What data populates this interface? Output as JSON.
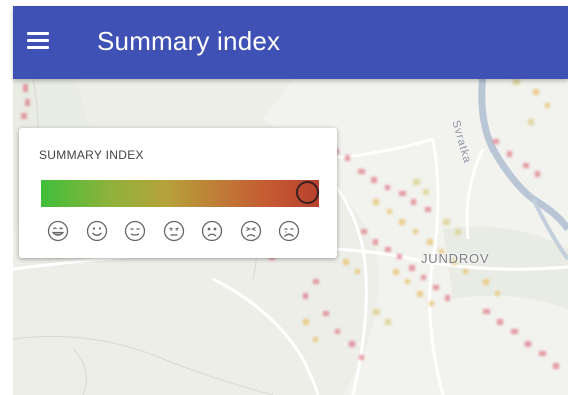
{
  "appbar": {
    "title": "Summary index",
    "menu_icon": "menu-icon",
    "color": "#3f51b5"
  },
  "map": {
    "labels": {
      "district": "JUNDROV",
      "river": "Svratka"
    }
  },
  "legend": {
    "title": "SUMMARY INDEX",
    "selected_fraction": 1.0,
    "gradient_colors": [
      "#3fbf3a",
      "#b5a23a",
      "#b8412c"
    ],
    "faces": [
      "grinning-face-icon",
      "smiling-face-icon",
      "relieved-face-icon",
      "unamused-face-icon",
      "worried-face-icon",
      "persevering-face-icon",
      "crying-face-icon"
    ]
  }
}
